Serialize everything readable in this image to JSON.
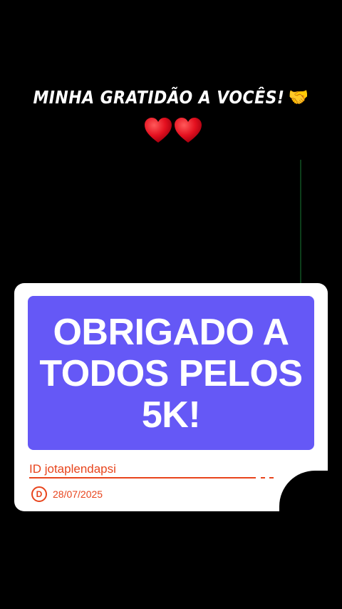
{
  "caption": {
    "text": "MINHA GRATIDÃO A VOCÊS!",
    "emoji": "🤝"
  },
  "hearts": {
    "count": 2,
    "color": "#e4101f",
    "icon": "heart-icon"
  },
  "card": {
    "headline": "OBRIGADO A\nTODOS PELOS\n5K!",
    "headline_bg": "#6558f6",
    "id_label": "ID  jotaplendapsi",
    "badge_letter": "D",
    "date": "28/07/2025",
    "accent": "#e8441c"
  }
}
